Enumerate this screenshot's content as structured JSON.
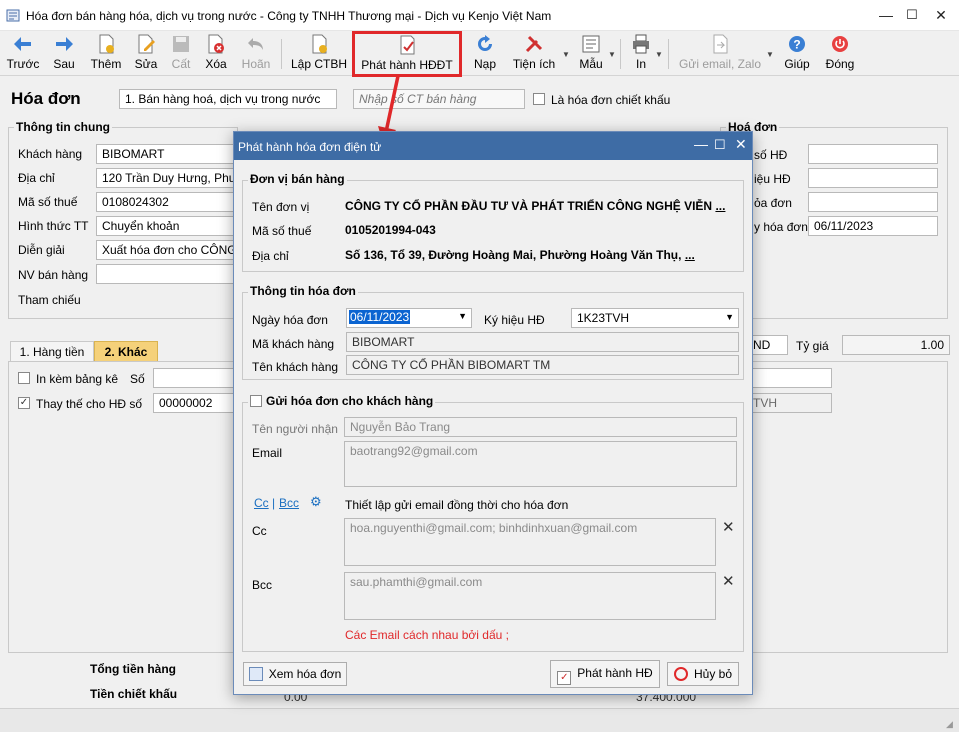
{
  "window": {
    "title": "Hóa đơn bán hàng hóa, dịch vụ trong nước - Công ty TNHH Thương mại - Dịch vụ Kenjo Việt Nam"
  },
  "toolbar": {
    "prev": "Trước",
    "next": "Sau",
    "add": "Thêm",
    "edit": "Sửa",
    "save": "Cất",
    "delete": "Xóa",
    "undo": "Hoãn",
    "lap_ctbh": "Lập CTBH",
    "issue_einvoice": "Phát hành HĐĐT",
    "reload": "Nạp",
    "utilities": "Tiện ích",
    "template": "Mẫu",
    "print": "In",
    "send": "Gửi email, Zalo",
    "help": "Giúp",
    "close": "Đóng"
  },
  "header": {
    "title": "Hóa đơn",
    "type_value": "1. Bán hàng hoá, dịch vụ trong nước",
    "ct_placeholder": "Nhập số CT bán hàng",
    "discount_label": "Là hóa đơn chiết khấu"
  },
  "general": {
    "section": "Thông tin chung",
    "customer_label": "Khách hàng",
    "customer_value": "BIBOMART",
    "address_label": "Địa chỉ",
    "address_value": "120 Trần Duy Hưng, Phường",
    "tax_label": "Mã số thuế",
    "tax_value": "0108024302",
    "payment_label": "Hình thức TT",
    "payment_value": "Chuyển khoản",
    "desc_label": "Diễn giải",
    "desc_value": "Xuất hóa đơn cho CÔNG T",
    "sales_label": "NV bán hàng",
    "ref_label": "Tham chiếu"
  },
  "invoice_side": {
    "section": "Hoá đơn",
    "labels": [
      "số HĐ",
      "iệu HĐ",
      "ỏa đơn",
      "y hóa đơn"
    ],
    "date_value": "06/11/2023",
    "currency_value": "ND",
    "rate_label": "Tỷ giá",
    "rate_value": "1.00",
    "tvh_value": "TVH"
  },
  "tabs": {
    "tab1": "1. Hàng tiền",
    "tab2": "2. Khác",
    "print_list_label": "In kèm bảng kê",
    "so_label": "Số",
    "replace_label": "Thay thế cho HĐ số",
    "replace_value": "00000002"
  },
  "totals": {
    "total_goods": "Tổng tiền hàng",
    "discount": "Tiền chiết khấu",
    "discount_value": "0.00",
    "pay_value": "37.400.000"
  },
  "dialog": {
    "title": "Phát hành hóa đơn điện tử",
    "seller_section": "Đơn vị bán hàng",
    "unit_label": "Tên đơn vị",
    "unit_value": "CÔNG TY CỔ PHẦN ĐẦU TƯ VÀ PHÁT TRIỂN CÔNG NGHỆ VIỄN",
    "unit_more": "...",
    "tax_label": "Mã số thuế",
    "tax_value": "0105201994-043",
    "addr_label": "Địa chỉ",
    "addr_value": "Số 136, Tổ 39, Đường Hoàng Mai, Phường Hoàng Văn Thụ,",
    "addr_more": "...",
    "invoice_section": "Thông tin hóa đơn",
    "date_label": "Ngày hóa đơn",
    "date_value": "06/11/2023",
    "symbol_label": "Ký hiệu HĐ",
    "symbol_value": "1K23TVH",
    "cust_code_label": "Mã khách hàng",
    "cust_code_value": "BIBOMART",
    "cust_name_label": "Tên khách hàng",
    "cust_name_value": "CÔNG TY CỔ PHẦN BIBOMART TM",
    "send_section": "Gửi hóa đơn cho khách hàng",
    "recipient_label": "Tên người nhận",
    "recipient_value": "Nguyễn Bảo Trang",
    "email_label": "Email",
    "email_value": "baotrang92@gmail.com",
    "cc_link": "Cc",
    "bcc_link": "Bcc",
    "cc_setting_text": "Thiết lập gửi email đồng thời cho hóa đơn",
    "cc_label": "Cc",
    "cc_value": "hoa.nguyenthi@gmail.com; binhdinhxuan@gmail.com",
    "bcc_label": "Bcc",
    "bcc_value": "sau.phamthi@gmail.com",
    "note": "Các Email cách nhau bởi dấu ;",
    "view_button": "Xem hóa đơn",
    "issue_button": "Phát hành HĐ",
    "cancel_button": "Hủy bỏ"
  },
  "colors": {
    "dialog_title_bar": "#3e6ca5",
    "highlight": "#e0282a",
    "link": "#1b6fc1"
  }
}
